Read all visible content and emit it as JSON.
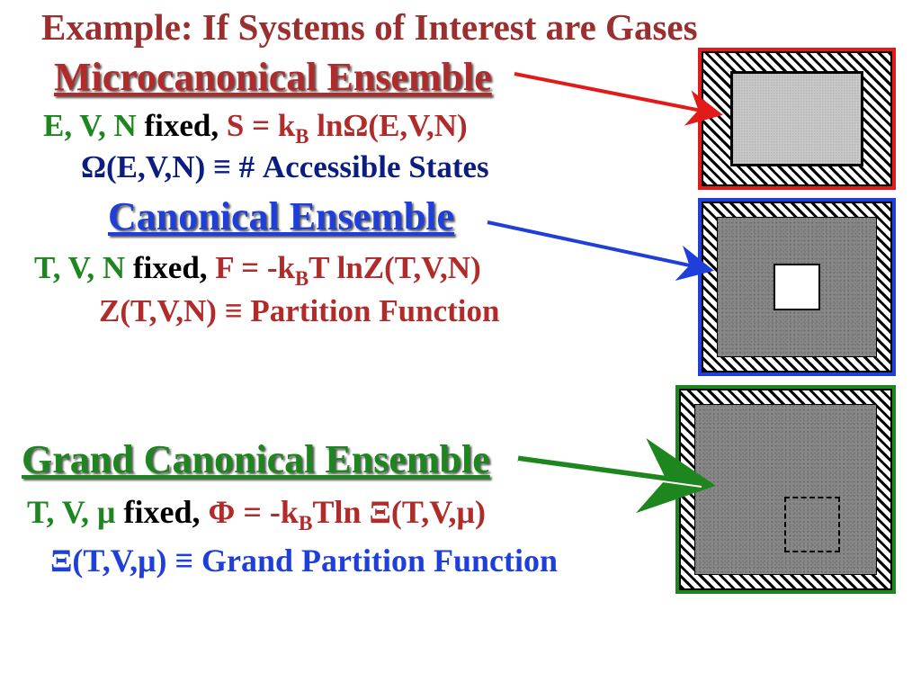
{
  "title": "Example: If Systems of Interest are Gases",
  "microcanonical": {
    "heading": "Microcanonical Ensemble",
    "line1": {
      "vars": "E, V, N",
      "fixed": " fixed, ",
      "eq_a": "S = k",
      "eq_sub": "B",
      "eq_b": " lnΩ(E,V,N)"
    },
    "line2": "Ω(E,V,N) ≡ # Accessible States"
  },
  "canonical": {
    "heading": "Canonical Ensemble",
    "line1": {
      "vars": "T, V, N",
      "fixed": " fixed, ",
      "eq_a": "F = -k",
      "eq_sub": "B",
      "eq_b": "T lnZ(T,V,N)"
    },
    "line2": "Z(T,V,N) ≡ Partition Function"
  },
  "grand": {
    "heading": "Grand Canonical Ensemble",
    "line1": {
      "vars": "T, V, μ",
      "fixed": " fixed, ",
      "eq_a": "Φ = -k",
      "eq_sub": "B",
      "eq_b": "Tln Ξ(T,V,μ)"
    },
    "line2": "Ξ(T,V,μ) ≡ Grand Partition Function"
  }
}
